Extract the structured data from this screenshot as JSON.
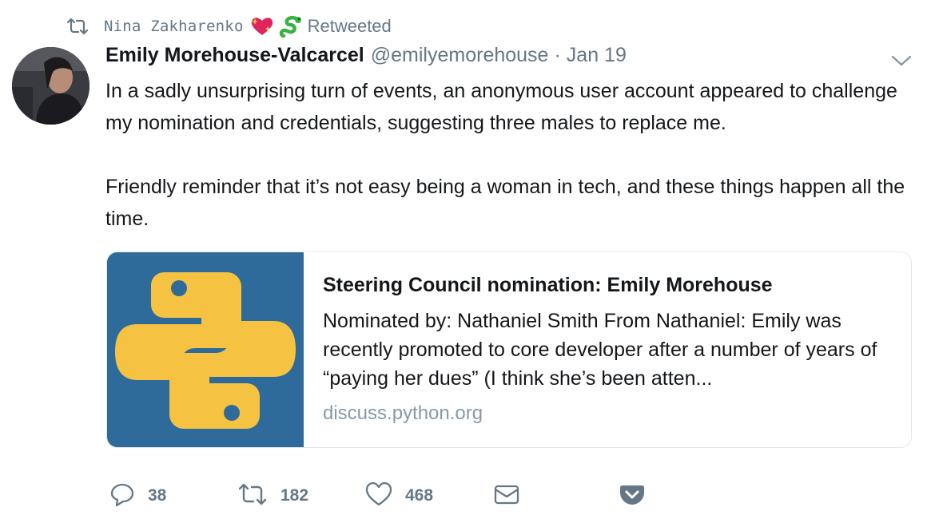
{
  "context": {
    "retweeter_name": "Nina Zakharenko",
    "label": "Retweeted"
  },
  "tweet": {
    "author_name": "Emily Morehouse-Valcarcel",
    "handle": "@emilyemorehouse",
    "separator": "·",
    "date": "Jan 19",
    "paragraph1": "In a sadly unsurprising turn of events, an anonymous user account appeared to challenge my nomination and credentials, suggesting three males to replace me.",
    "paragraph2": "Friendly reminder that it’s not easy being a woman in tech, and these things happen all the time."
  },
  "card": {
    "title": "Steering Council nomination: Emily Morehouse",
    "description": "Nominated by: Nathaniel Smith From Nathaniel: Emily was recently promoted to core developer after a number of years of “paying her dues” (I think she’s been atten...",
    "domain": "discuss.python.org",
    "thumbnail_icon": "python-logo-icon"
  },
  "actions": {
    "reply_count": "38",
    "retweet_count": "182",
    "like_count": "468"
  },
  "colors": {
    "secondary_text": "#657786",
    "card_border": "#e1e8ed",
    "python_blue": "#2f6b9a",
    "python_yellow": "#f5c242"
  }
}
